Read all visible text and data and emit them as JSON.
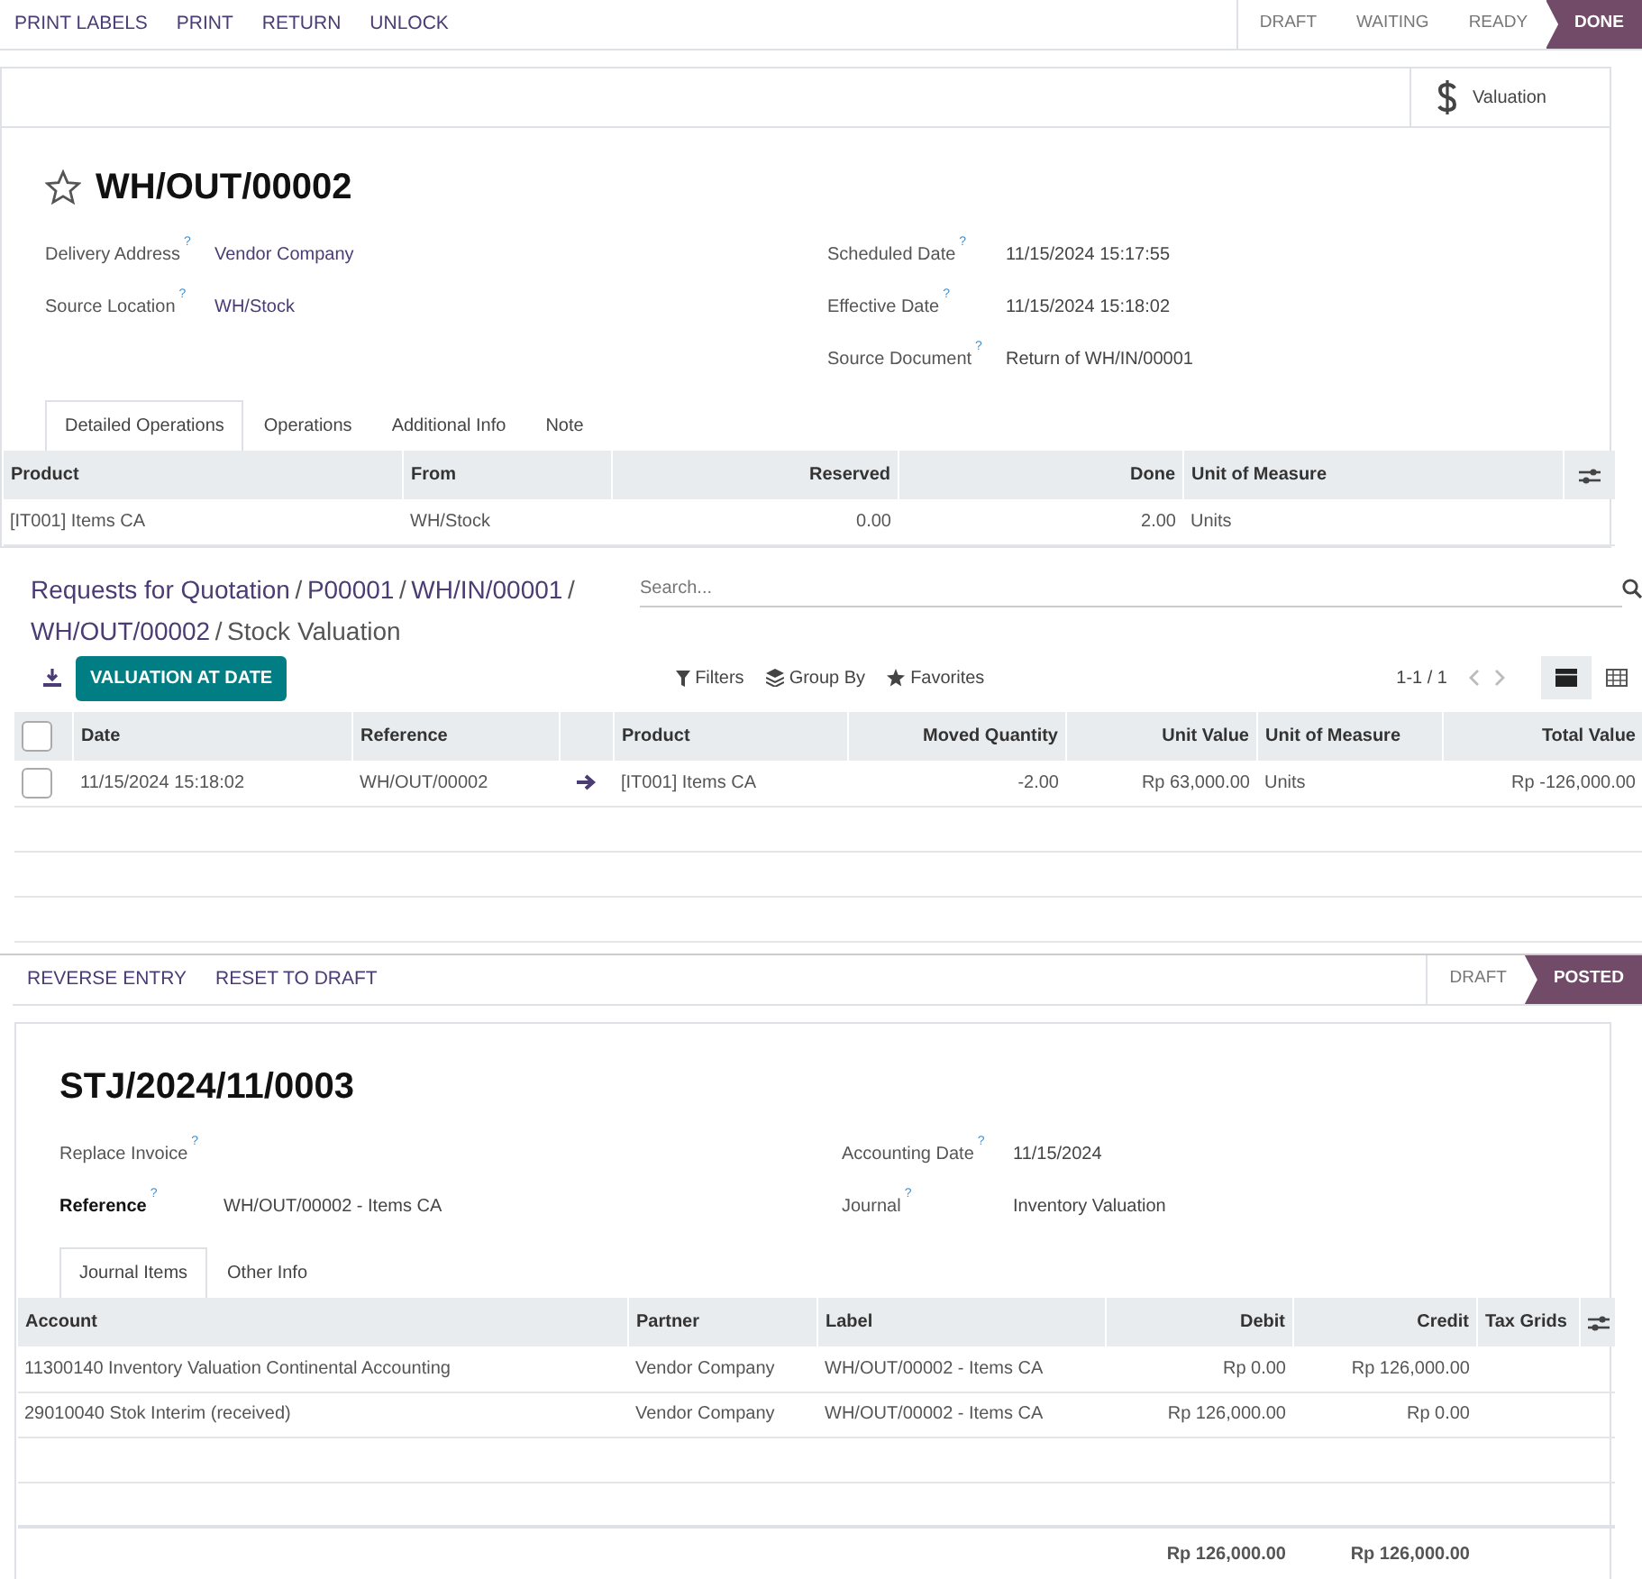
{
  "picking": {
    "actions": [
      "PRINT LABELS",
      "PRINT",
      "RETURN",
      "UNLOCK"
    ],
    "stages": [
      {
        "label": "DRAFT",
        "selected": false
      },
      {
        "label": "WAITING",
        "selected": false
      },
      {
        "label": "READY",
        "selected": false
      },
      {
        "label": "DONE",
        "selected": true
      }
    ],
    "smart_buttons": [
      {
        "label": "Valuation"
      }
    ],
    "title": "WH/OUT/00002",
    "starred": false,
    "fields_left": [
      {
        "label": "Delivery Address",
        "help": "?",
        "value": "Vendor Company",
        "link": true
      },
      {
        "label": "Source Location",
        "help": "?",
        "value": "WH/Stock",
        "link": true
      }
    ],
    "fields_right": [
      {
        "label": "Scheduled Date",
        "help": "?",
        "value": "11/15/2024 15:17:55",
        "link": false
      },
      {
        "label": "Effective Date",
        "help": "?",
        "value": "11/15/2024 15:18:02",
        "link": false
      },
      {
        "label": "Source Document",
        "help": "?",
        "value": "Return of WH/IN/00001",
        "link": false
      }
    ],
    "tabs": [
      {
        "label": "Detailed Operations",
        "selected": true
      },
      {
        "label": "Operations",
        "selected": false
      },
      {
        "label": "Additional Info",
        "selected": false
      },
      {
        "label": "Note",
        "selected": false
      }
    ],
    "table": {
      "optional_columns": true,
      "columns": [
        {
          "kind": "text",
          "label": "Product"
        },
        {
          "kind": "text",
          "label": "From"
        },
        {
          "kind": "number",
          "label": "Reserved"
        },
        {
          "kind": "number",
          "label": "Done"
        },
        {
          "kind": "text",
          "label": "Unit of Measure"
        }
      ],
      "rows": [
        {
          "cells": [
            "[IT001] Items CA",
            "WH/Stock",
            "0.00",
            "2.00",
            "Units"
          ]
        }
      ]
    }
  },
  "valuation": {
    "breadcrumb": [
      {
        "label": "Requests for Quotation",
        "current": false
      },
      {
        "label": "P00001",
        "current": false
      },
      {
        "label": "WH/IN/00001",
        "current": false
      },
      {
        "label": "WH/OUT/00002",
        "current": false
      },
      {
        "label": "Stock Valuation",
        "current": true
      }
    ],
    "separator": "/",
    "search": {
      "placeholder": "Search..."
    },
    "primary_button": "VALUATION AT DATE",
    "filters": [
      {
        "kind": "filter",
        "label": "Filters"
      },
      {
        "kind": "group",
        "label": "Group By"
      },
      {
        "kind": "favorites",
        "label": "Favorites"
      }
    ],
    "pager": "1-1 / 1",
    "views": [
      {
        "kind": "list",
        "selected": true
      },
      {
        "kind": "pivot",
        "selected": false
      }
    ],
    "table": {
      "header_checked": false,
      "columns": [
        {
          "kind": "text",
          "label": "Date"
        },
        {
          "kind": "text",
          "label": "Reference",
          "link_after": true
        },
        {
          "kind": "text",
          "label": "Product"
        },
        {
          "kind": "number",
          "label": "Moved Quantity"
        },
        {
          "kind": "number",
          "label": "Unit Value"
        },
        {
          "kind": "text",
          "label": "Unit of Measure"
        },
        {
          "kind": "number",
          "label": "Total Value"
        }
      ],
      "rows": [
        {
          "checked": false,
          "cells": [
            "11/15/2024 15:18:02",
            "WH/OUT/00002",
            "[IT001] Items CA",
            "-2.00",
            "Rp 63,000.00",
            "Units",
            "Rp -126,000.00"
          ]
        }
      ]
    }
  },
  "entry": {
    "actions": [
      "REVERSE ENTRY",
      "RESET TO DRAFT"
    ],
    "stages": [
      {
        "label": "DRAFT",
        "selected": false
      },
      {
        "label": "POSTED",
        "selected": true
      }
    ],
    "title": "STJ/2024/11/0003",
    "fields_left": [
      {
        "label": "Replace Invoice",
        "help": "?",
        "bold": false
      },
      {
        "label": "Reference",
        "help": "?",
        "bold": true,
        "value": "WH/OUT/00002 - Items CA"
      }
    ],
    "fields_right": [
      {
        "label": "Accounting Date",
        "help": "?",
        "bold": false,
        "value": "11/15/2024"
      },
      {
        "label": "Journal",
        "help": "?",
        "bold": false,
        "value": "Inventory Valuation"
      }
    ],
    "tabs": [
      {
        "label": "Journal Items",
        "selected": true
      },
      {
        "label": "Other Info",
        "selected": false
      }
    ],
    "table": {
      "optional_columns": true,
      "columns": [
        {
          "kind": "text",
          "label": "Account"
        },
        {
          "kind": "text",
          "label": "Partner"
        },
        {
          "kind": "text",
          "label": "Label"
        },
        {
          "kind": "number",
          "label": "Debit",
          "total": "Rp 126,000.00"
        },
        {
          "kind": "number",
          "label": "Credit",
          "total": "Rp 126,000.00"
        },
        {
          "kind": "text",
          "label": "Tax Grids"
        }
      ],
      "rows": [
        {
          "cells": [
            "11300140 Inventory Valuation Continental Accounting",
            "Vendor Company",
            "WH/OUT/00002 - Items CA",
            "Rp 0.00",
            "Rp 126,000.00"
          ]
        },
        {
          "cells": [
            "29010040 Stok Interim (received)",
            "Vendor Company",
            "WH/OUT/00002 - Items CA",
            "Rp 126,000.00",
            "Rp 0.00"
          ]
        }
      ]
    }
  }
}
